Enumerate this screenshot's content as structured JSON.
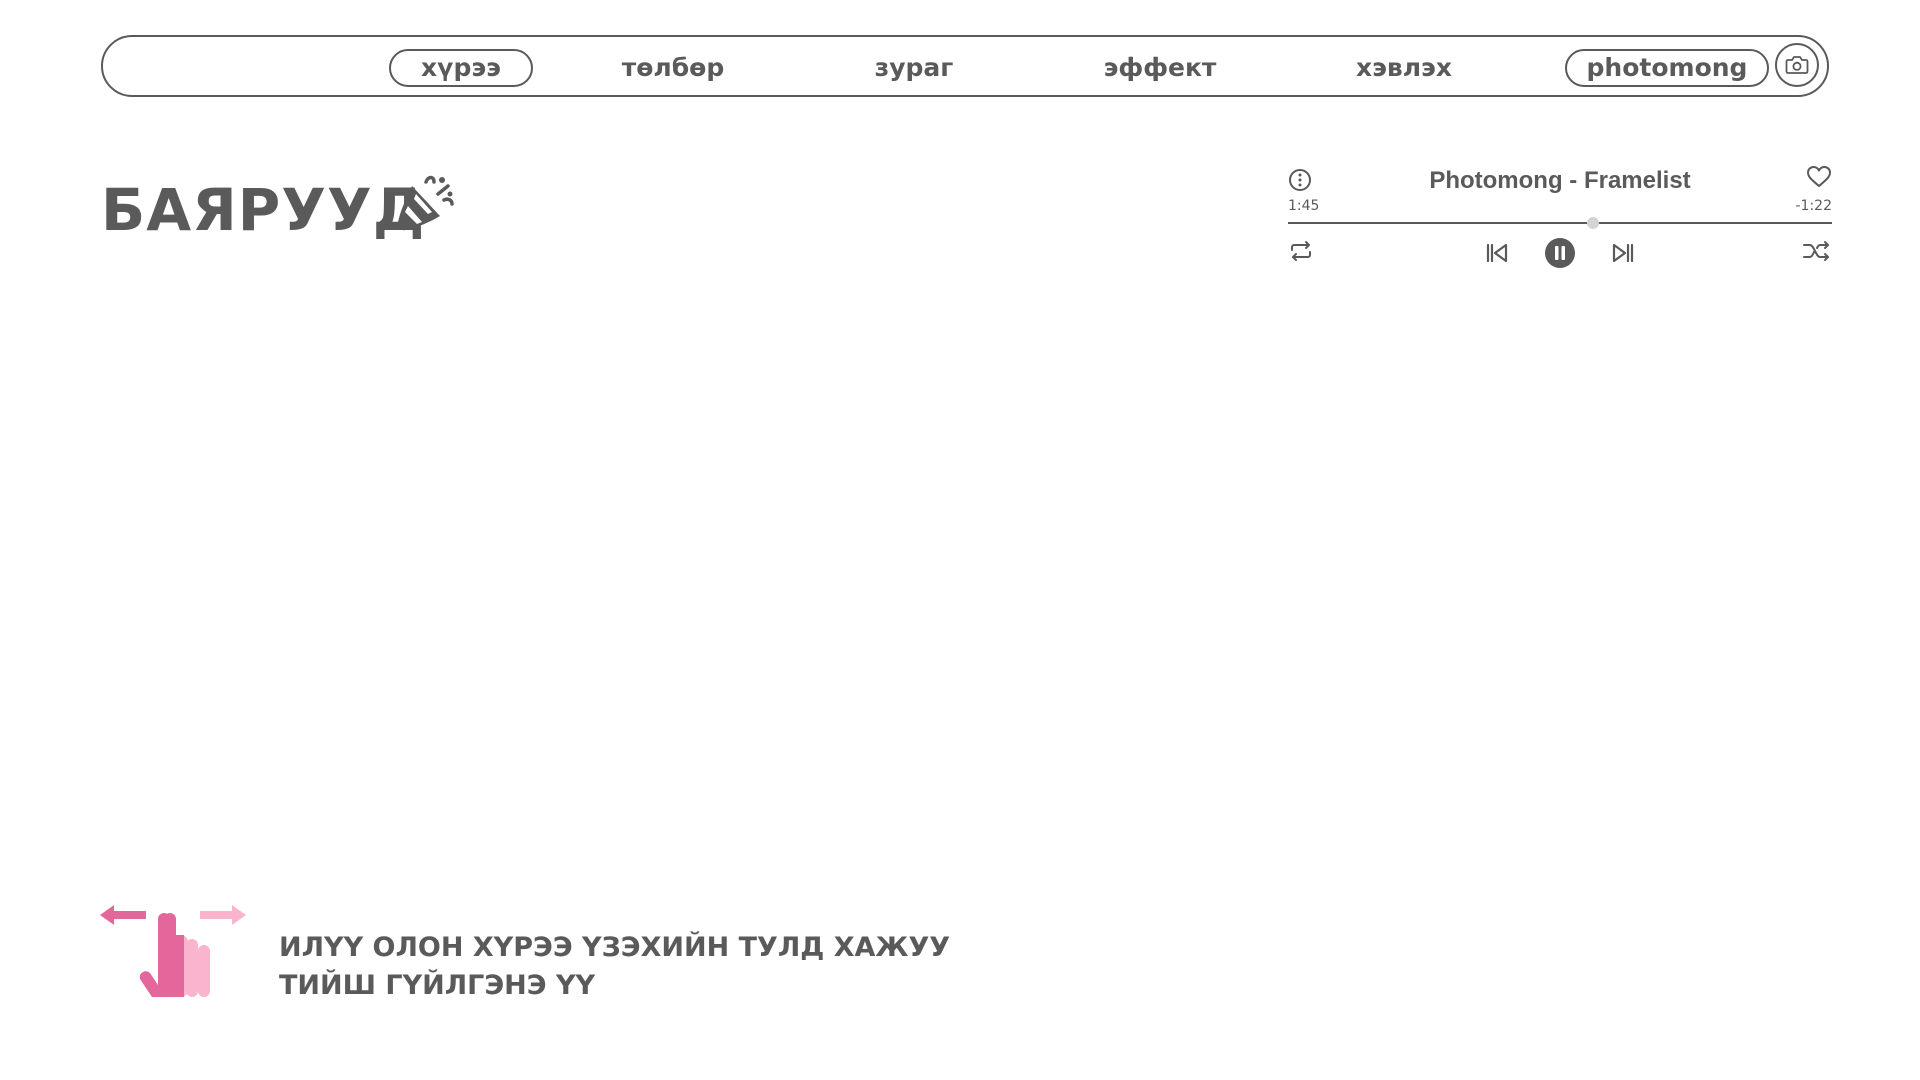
{
  "nav": {
    "items": [
      {
        "label": "хүрээ",
        "active": true
      },
      {
        "label": "төлбөр"
      },
      {
        "label": "зураг"
      },
      {
        "label": "эффект"
      },
      {
        "label": "хэвлэх"
      }
    ],
    "brand": "photomong",
    "camera_icon": "camera-icon"
  },
  "page": {
    "title": "БАЯРУУД",
    "title_icon": "party-popper-icon"
  },
  "player": {
    "track": "Photomong - Framelist",
    "elapsed": "1:45",
    "remaining": "-1:22",
    "progress": 0.56,
    "state": "playing",
    "icons": [
      "info-icon",
      "heart-icon",
      "repeat-icon",
      "previous-icon",
      "pause-icon",
      "next-icon",
      "shuffle-icon"
    ]
  },
  "hint": {
    "line1": "ИЛҮҮ ОЛОН ХҮРЭЭ ҮЗЭХИЙН ТУЛД ХАЖУУ",
    "line2": "ТИЙШ ГҮЙЛГЭНЭ ҮҮ",
    "icon": "swipe-gesture-icon"
  },
  "colors": {
    "text": "#5a5a5a",
    "accent_pink": "#e4679c",
    "light_pink": "#fbb4cd",
    "thumb": "#d4d4d4"
  }
}
